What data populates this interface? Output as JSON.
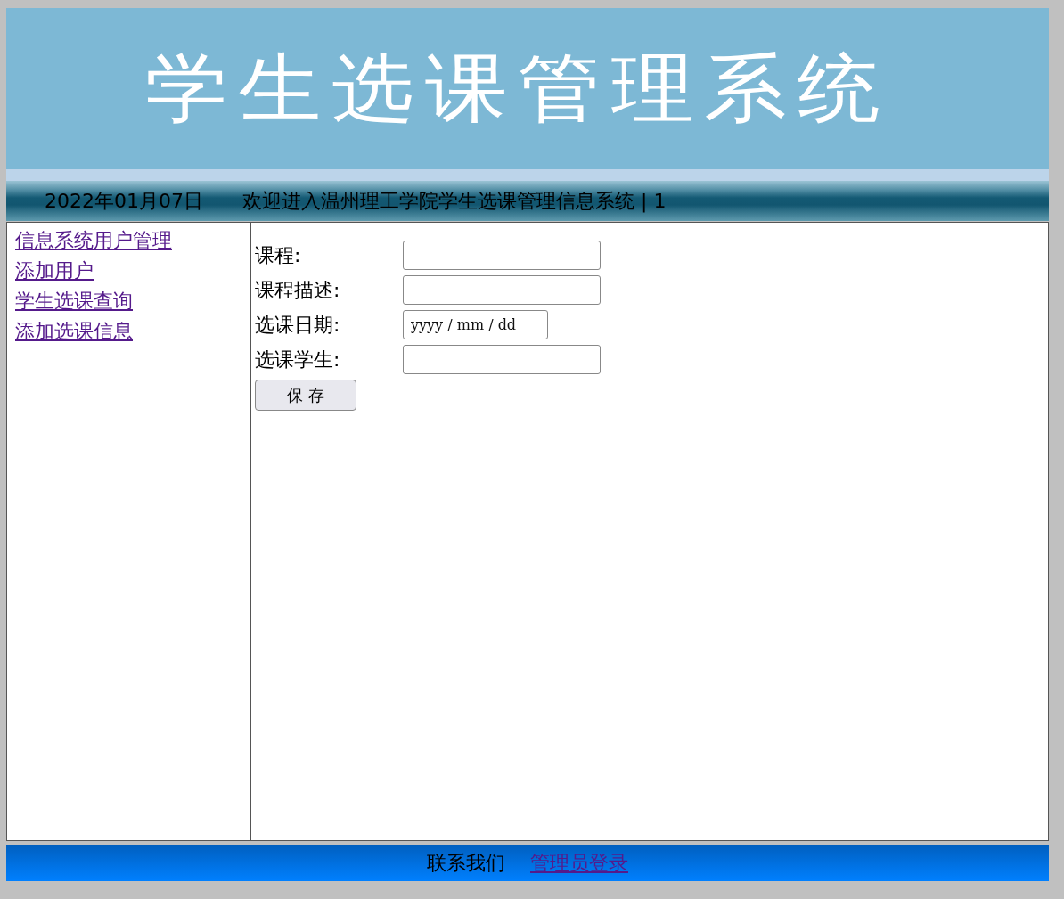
{
  "banner": {
    "title": "学生选课管理系统"
  },
  "info_bar": {
    "date": "2022年01月07日",
    "welcome": "欢迎进入温州理工学院学生选课管理信息系统 | 1"
  },
  "sidebar": {
    "links": [
      "信息系统用户管理",
      "添加用户",
      "学生选课查询",
      "添加选课信息"
    ]
  },
  "form": {
    "fields": [
      {
        "label": "课程:",
        "kind": "text"
      },
      {
        "label": "课程描述:",
        "kind": "text"
      },
      {
        "label": "选课日期:",
        "kind": "date",
        "placeholder": "yyyy / mm / dd"
      },
      {
        "label": "选课学生:",
        "kind": "text"
      }
    ],
    "submit": "保 存"
  },
  "footer": {
    "contact": "联系我们",
    "admin_link": "管理员登录"
  }
}
